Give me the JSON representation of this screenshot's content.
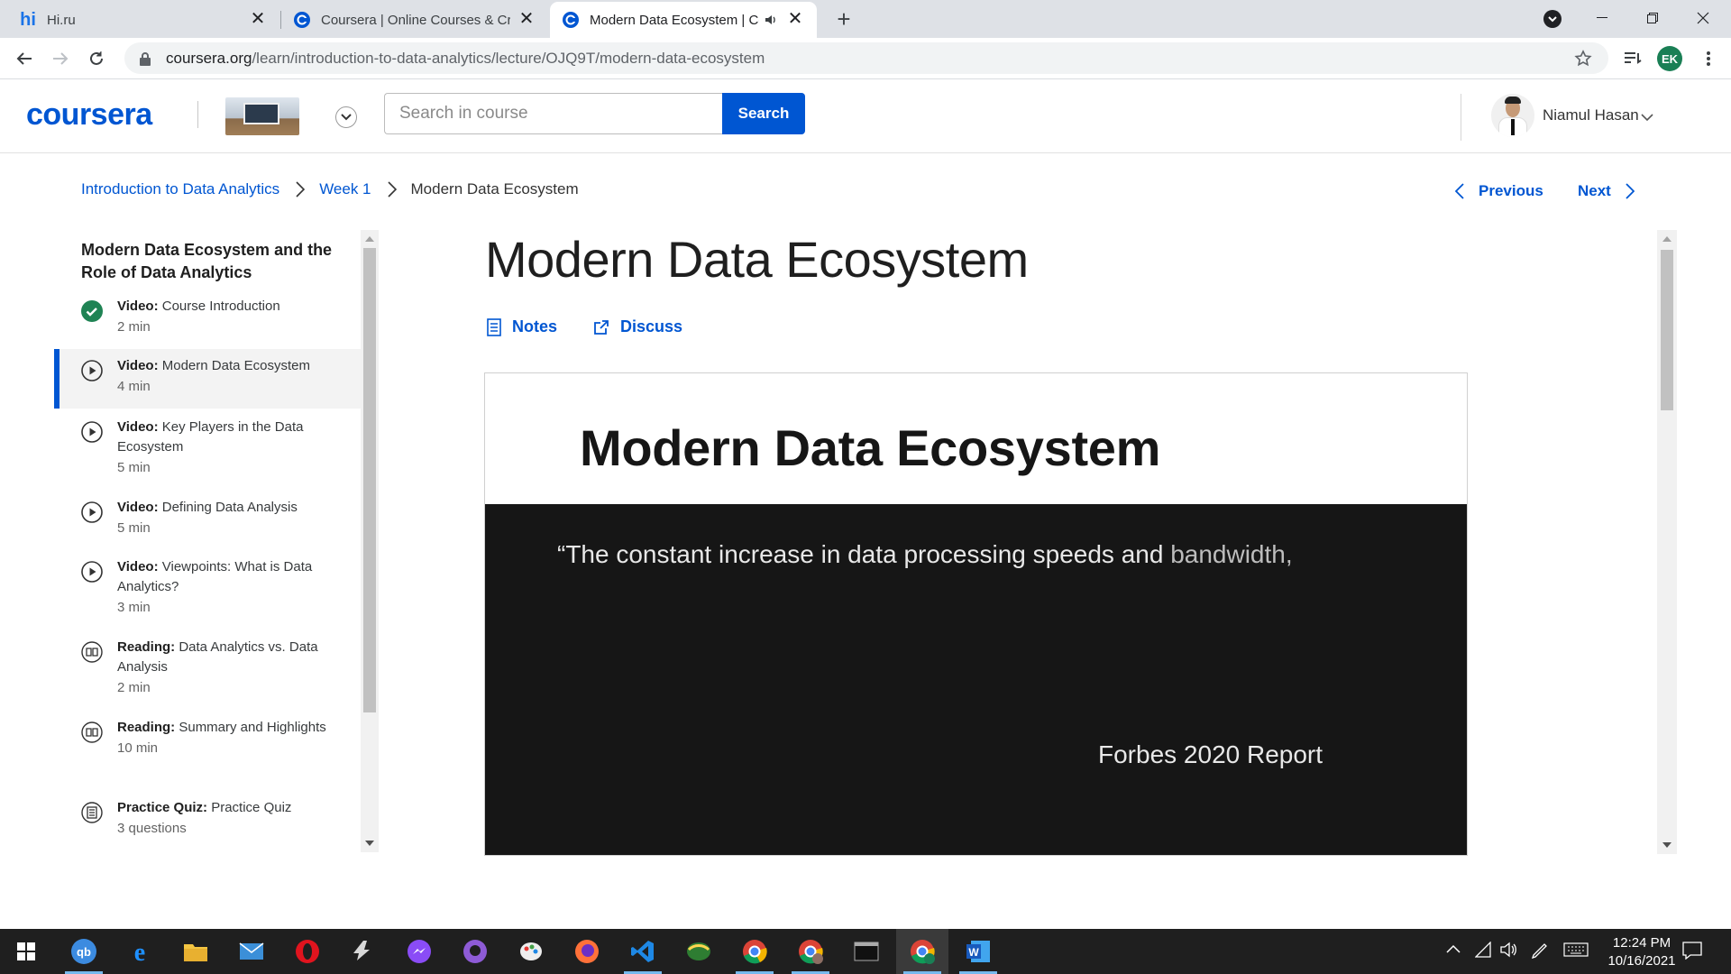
{
  "browser": {
    "tabs": [
      {
        "title": "Hi.ru",
        "close": "✕"
      },
      {
        "title": "Coursera | Online Courses & Cred",
        "close": "✕"
      },
      {
        "title": "Modern Data Ecosystem | Co",
        "close": "✕"
      }
    ],
    "new_tab": "+",
    "url_host": "coursera.org",
    "url_path": "/learn/introduction-to-data-analytics/lecture/OJQ9T/modern-data-ecosystem",
    "profile_initials": "EK"
  },
  "header": {
    "logo": "coursera",
    "search_placeholder": "Search in course",
    "search_button": "Search",
    "user_name": "Niamul Hasan"
  },
  "breadcrumb": {
    "course": "Introduction to Data Analytics",
    "week": "Week 1",
    "current": "Modern Data Ecosystem"
  },
  "nav": {
    "previous": "Previous",
    "next": "Next"
  },
  "sidebar": {
    "title": "Modern Data Ecosystem and the Role of Data Analytics",
    "items": [
      {
        "type": "Video:",
        "name": "Course Introduction",
        "duration": "2 min",
        "icon": "check-circle-icon"
      },
      {
        "type": "Video:",
        "name": "Modern Data Ecosystem",
        "duration": "4 min",
        "icon": "play-circle-icon"
      },
      {
        "type": "Video:",
        "name": "Key Players in the Data Ecosystem",
        "duration": "5 min",
        "icon": "play-circle-icon"
      },
      {
        "type": "Video:",
        "name": "Defining Data Analysis",
        "duration": "5 min",
        "icon": "play-circle-icon"
      },
      {
        "type": "Video:",
        "name": "Viewpoints: What is Data Analytics?",
        "duration": "3 min",
        "icon": "play-circle-icon"
      },
      {
        "type": "Reading:",
        "name": "Data Analytics vs. Data Analysis",
        "duration": "2 min",
        "icon": "book-icon"
      },
      {
        "type": "Reading:",
        "name": "Summary and Highlights",
        "duration": "10 min",
        "icon": "book-icon"
      },
      {
        "type": "Practice Quiz:",
        "name": "Practice Quiz",
        "duration": "3 questions",
        "icon": "quiz-icon"
      }
    ]
  },
  "lecture": {
    "title": "Modern Data Ecosystem",
    "notes": "Notes",
    "discuss": "Discuss",
    "slide_title": "Modern Data Ecosystem",
    "quote_main": "“The constant increase in data processing speeds and",
    "quote_dim": " bandwidth,",
    "source": "Forbes 2020 Report"
  },
  "taskbar": {
    "time": "12:24 PM",
    "date": "10/16/2021"
  },
  "colors": {
    "brand": "#0056d2",
    "taskbar": "#1f1f1f"
  }
}
